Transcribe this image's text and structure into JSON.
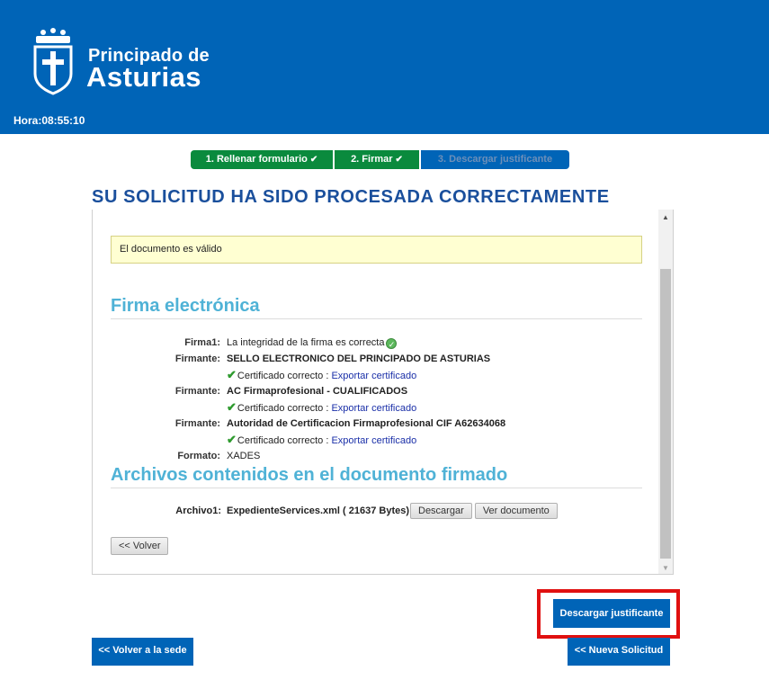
{
  "header": {
    "logo_line1": "Principado de",
    "logo_line2": "Asturias",
    "clock": "Hora:08:55:10"
  },
  "steps": [
    {
      "label": "1. Rellenar formulario",
      "state": "done"
    },
    {
      "label": "2. Firmar",
      "state": "done"
    },
    {
      "label": "3. Descargar justificante",
      "state": "current"
    }
  ],
  "page_title": "SU SOLICITUD HA SIDO PROCESADA CORRECTAMENTE",
  "notice": "El documento es válido",
  "firma": {
    "heading": "Firma electrónica",
    "firma1_label": "Firma1:",
    "firma1_value": "La integridad de la firma es correcta",
    "firmantes": [
      {
        "label": "Firmante:",
        "name": "SELLO ELECTRONICO DEL PRINCIPADO DE ASTURIAS"
      },
      {
        "label": "Firmante:",
        "name": "AC Firmaprofesional - CUALIFICADOS"
      },
      {
        "label": "Firmante:",
        "name": "Autoridad de Certificacion Firmaprofesional CIF A62634068"
      }
    ],
    "cert_ok": "Certificado correcto :",
    "export_link": "Exportar certificado",
    "formato_label": "Formato:",
    "formato_value": "XADES"
  },
  "archivos": {
    "heading": "Archivos contenidos en el documento firmado",
    "label": "Archivo1:",
    "value": "ExpedienteServices.xml ( 21637 Bytes)",
    "download_label": "Descargar",
    "view_label": "Ver documento"
  },
  "volver_label": "<< Volver",
  "descargar_justificante_label": "Descargar justificante",
  "volver_sede_label": "<< Volver a la sede",
  "nueva_solicitud_label": "<< Nueva Solicitud",
  "colors": {
    "header_bg": "#0064b7",
    "step_done": "#0a8a3d",
    "title": "#1a4f9c",
    "section_heading": "#4fb2d6",
    "highlight": "#e01010"
  },
  "icons": {
    "ok": "check-circle-icon",
    "check": "checkmark-icon",
    "shield": "asturias-shield-icon"
  }
}
